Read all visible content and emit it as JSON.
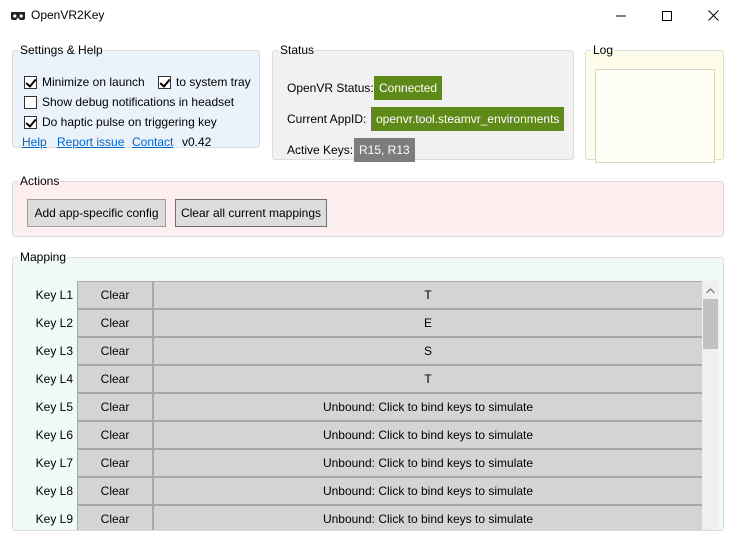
{
  "window": {
    "title": "OpenVR2Key",
    "icons": {
      "app": "vr-headset-icon",
      "minimize": "minimize-icon",
      "maximize": "maximize-icon",
      "close": "close-icon"
    }
  },
  "settings": {
    "legend": "Settings & Help",
    "minimize_on_launch": {
      "label": "Minimize on launch",
      "checked": true
    },
    "to_system_tray": {
      "label": "to system tray",
      "checked": true
    },
    "show_debug": {
      "label": "Show debug notifications in headset",
      "checked": false
    },
    "haptic_pulse": {
      "label": "Do haptic pulse on triggering key",
      "checked": true
    },
    "links": {
      "help": "Help",
      "report_issue": "Report issue",
      "contact": "Contact"
    },
    "version": "v0.42"
  },
  "status": {
    "legend": "Status",
    "openvr_status_label": "OpenVR Status:",
    "openvr_status_value": "Connected",
    "current_appid_label": "Current AppID:",
    "current_appid_value": "openvr.tool.steamvr_environments",
    "active_keys_label": "Active Keys:",
    "active_keys_value": "R15, R13"
  },
  "log": {
    "legend": "Log"
  },
  "actions": {
    "legend": "Actions",
    "add_config": "Add app-specific config",
    "clear_mappings": "Clear all current mappings"
  },
  "mapping": {
    "legend": "Mapping",
    "rows": [
      {
        "key": "Key L1",
        "clear": "Clear",
        "binding": "T"
      },
      {
        "key": "Key L2",
        "clear": "Clear",
        "binding": "E"
      },
      {
        "key": "Key L3",
        "clear": "Clear",
        "binding": "S"
      },
      {
        "key": "Key L4",
        "clear": "Clear",
        "binding": "T"
      },
      {
        "key": "Key L5",
        "clear": "Clear",
        "binding": "Unbound: Click to bind keys to simulate"
      },
      {
        "key": "Key L6",
        "clear": "Clear",
        "binding": "Unbound: Click to bind keys to simulate"
      },
      {
        "key": "Key L7",
        "clear": "Clear",
        "binding": "Unbound: Click to bind keys to simulate"
      },
      {
        "key": "Key L8",
        "clear": "Clear",
        "binding": "Unbound: Click to bind keys to simulate"
      },
      {
        "key": "Key L9",
        "clear": "Clear",
        "binding": "Unbound: Click to bind keys to simulate"
      },
      {
        "key": "",
        "clear": "",
        "binding": ""
      }
    ]
  },
  "colors": {
    "status_green": "#5e8a1a",
    "status_gray": "#7d7d7d",
    "link": "#0066cc",
    "settings_bg": "#eaf3fc",
    "actions_bg": "#fdeef0",
    "mapping_bg": "#eefaf3",
    "log_bg": "#fdfde9"
  }
}
